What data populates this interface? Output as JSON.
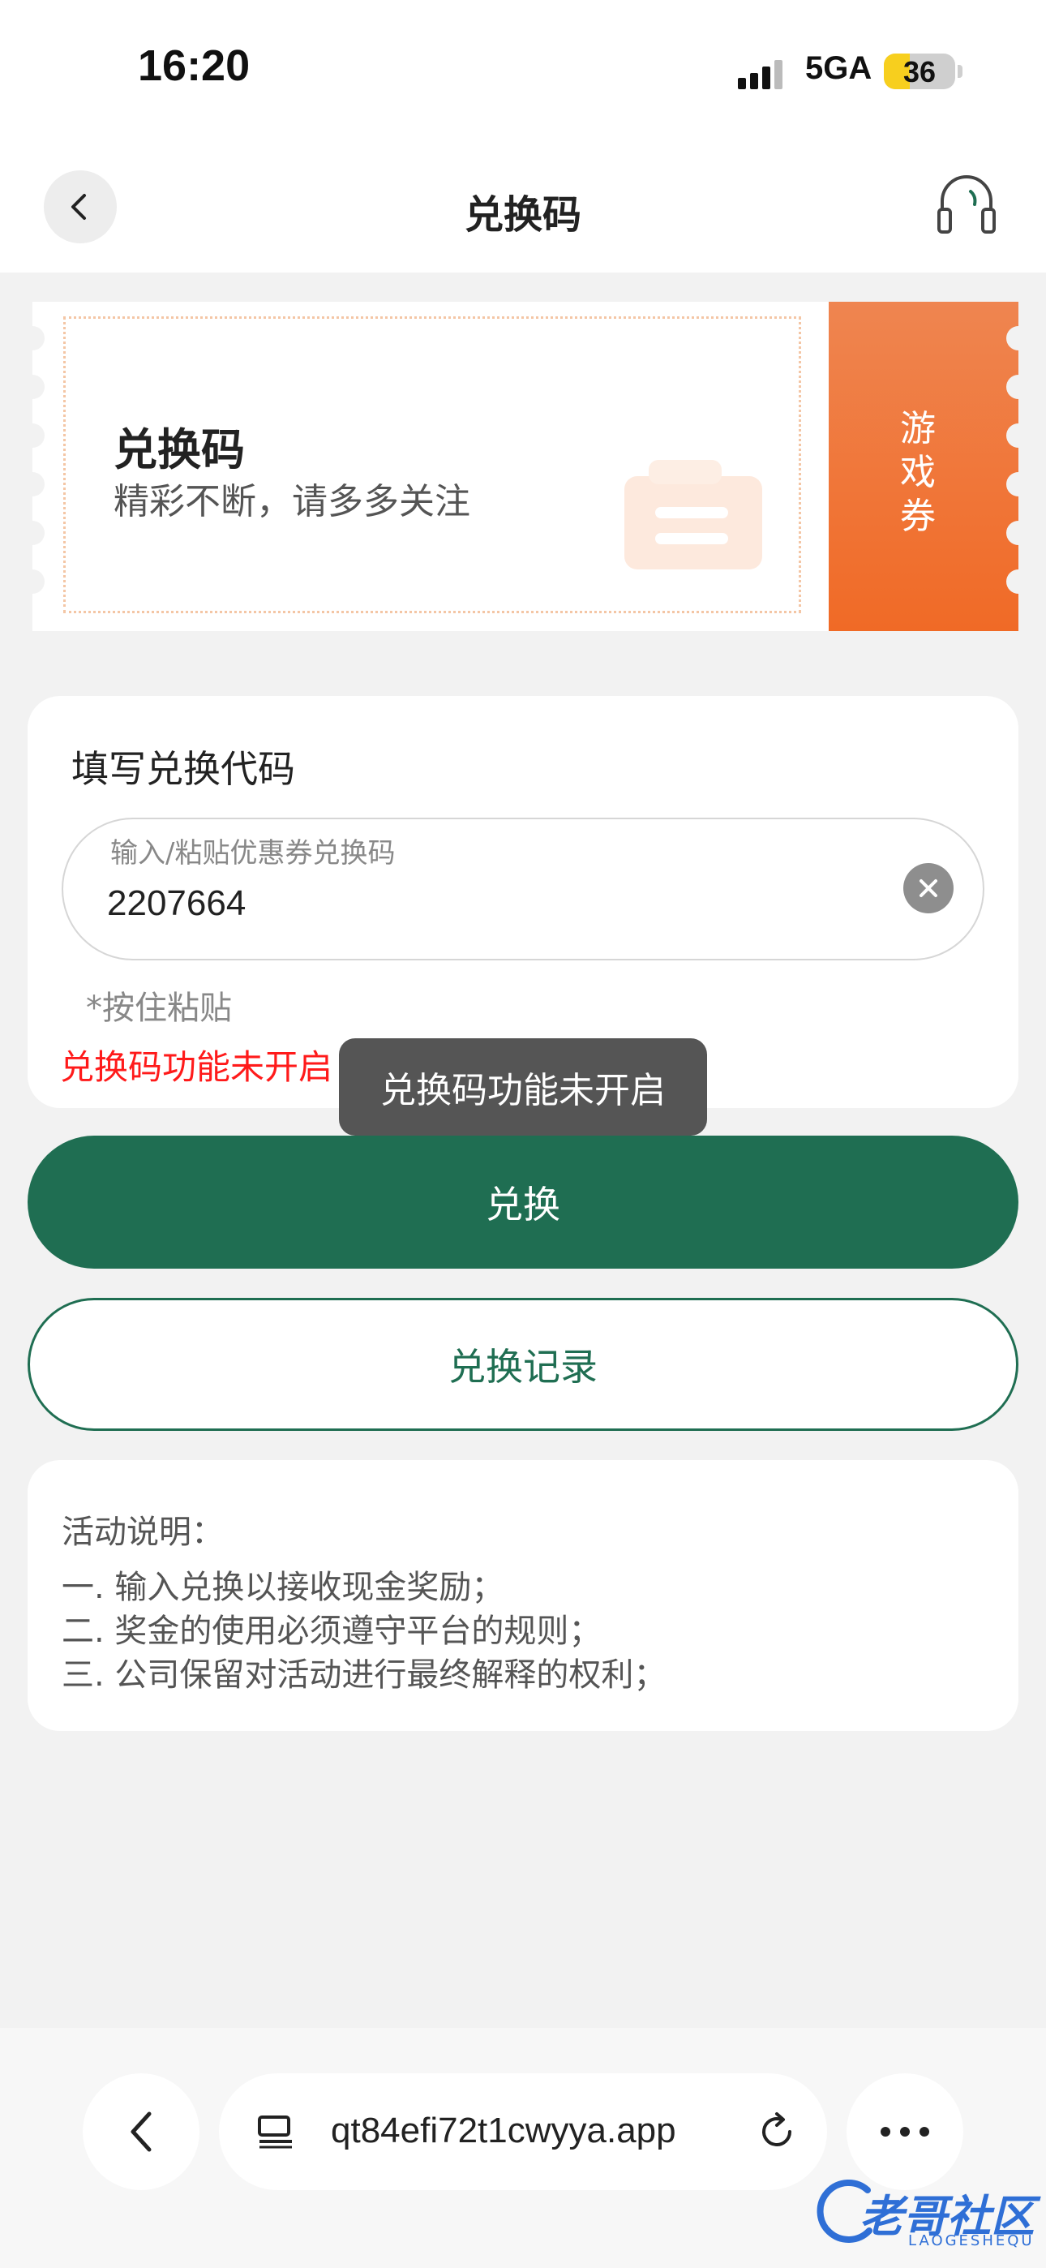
{
  "status_bar": {
    "time": "16:20",
    "network": "5GA",
    "battery": "36",
    "battery_level_percent": 36
  },
  "header": {
    "title": "兑换码",
    "back_icon": "chevron-left-icon",
    "support_icon": "headset-icon"
  },
  "banner": {
    "title": "兑换码",
    "subtitle": "精彩不断，请多多关注",
    "side_label": "游戏券"
  },
  "code_form": {
    "title": "填写兑换代码",
    "placeholder": "输入/粘贴优惠券兑换码",
    "value": "2207664",
    "hint": "*按住粘贴",
    "error": "兑换码功能未开启"
  },
  "toast": {
    "message": "兑换码功能未开启"
  },
  "buttons": {
    "redeem": "兑换",
    "history": "兑换记录"
  },
  "description": {
    "title": "活动说明：",
    "lines": [
      "一. 输入兑换以接收现金奖励；",
      "二. 奖金的使用必须遵守平台的规则；",
      "三. 公司保留对活动进行最终解释的权利；"
    ]
  },
  "browser": {
    "url": "qt84efi72t1cwyya.app"
  },
  "watermark": {
    "text": "老哥社区",
    "sub": "LAOGESHEQU"
  },
  "colors": {
    "primary": "#1f6e52",
    "ticket_orange": "#f06a26",
    "error": "#ff1a1a"
  }
}
